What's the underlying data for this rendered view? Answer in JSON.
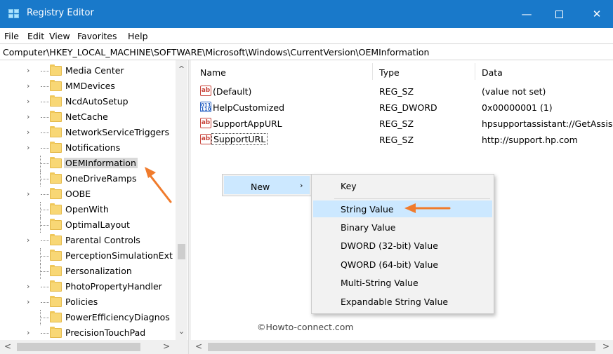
{
  "window": {
    "title": "Registry Editor",
    "controls": {
      "minimize": "—",
      "close": "✕"
    }
  },
  "menu": [
    "File",
    "Edit",
    "View",
    "Favorites",
    "Help"
  ],
  "address": "Computer\\HKEY_LOCAL_MACHINE\\SOFTWARE\\Microsoft\\Windows\\CurrentVersion\\OEMInformation",
  "tree": {
    "items": [
      {
        "label": "Media Center",
        "expandable": true
      },
      {
        "label": "MMDevices",
        "expandable": true
      },
      {
        "label": "NcdAutoSetup",
        "expandable": true
      },
      {
        "label": "NetCache",
        "expandable": true
      },
      {
        "label": "NetworkServiceTriggers",
        "expandable": true
      },
      {
        "label": "Notifications",
        "expandable": true
      },
      {
        "label": "OEMInformation",
        "expandable": false,
        "selected": true
      },
      {
        "label": "OneDriveRamps",
        "expandable": false
      },
      {
        "label": "OOBE",
        "expandable": true
      },
      {
        "label": "OpenWith",
        "expandable": false
      },
      {
        "label": "OptimalLayout",
        "expandable": false
      },
      {
        "label": "Parental Controls",
        "expandable": true
      },
      {
        "label": "PerceptionSimulationExt",
        "expandable": false
      },
      {
        "label": "Personalization",
        "expandable": false
      },
      {
        "label": "PhotoPropertyHandler",
        "expandable": true
      },
      {
        "label": "Policies",
        "expandable": true
      },
      {
        "label": "PowerEfficiencyDiagnos",
        "expandable": false
      },
      {
        "label": "PrecisionTouchPad",
        "expandable": true
      }
    ],
    "chevron": "›",
    "scroll_up": "^",
    "scroll_down": "⌄"
  },
  "values": {
    "headers": {
      "name": "Name",
      "type": "Type",
      "data": "Data"
    },
    "rows": [
      {
        "icon": "ab",
        "name": "(Default)",
        "type": "REG_SZ",
        "data": "(value not set)"
      },
      {
        "icon": "dword",
        "name": "HelpCustomized",
        "type": "REG_DWORD",
        "data": "0x00000001 (1)"
      },
      {
        "icon": "ab",
        "name": "SupportAppURL",
        "type": "REG_SZ",
        "data": "hpsupportassistant://GetAssis"
      },
      {
        "icon": "ab",
        "name": "SupportURL",
        "type": "REG_SZ",
        "data": "http://support.hp.com"
      }
    ]
  },
  "context_menu": {
    "new_label": "New",
    "new_arrow": "›",
    "submenu": [
      "Key",
      "String Value",
      "Binary Value",
      "DWORD (32-bit) Value",
      "QWORD (64-bit) Value",
      "Multi-String Value",
      "Expandable String Value"
    ],
    "highlighted": "String Value"
  },
  "watermark": "©Howto-connect.com",
  "scroll_arrows": {
    "left": "<",
    "right": ">"
  },
  "colors": {
    "titlebar": "#1979ca",
    "selection": "#cce8ff",
    "annotation_arrow": "#f07b2c"
  }
}
